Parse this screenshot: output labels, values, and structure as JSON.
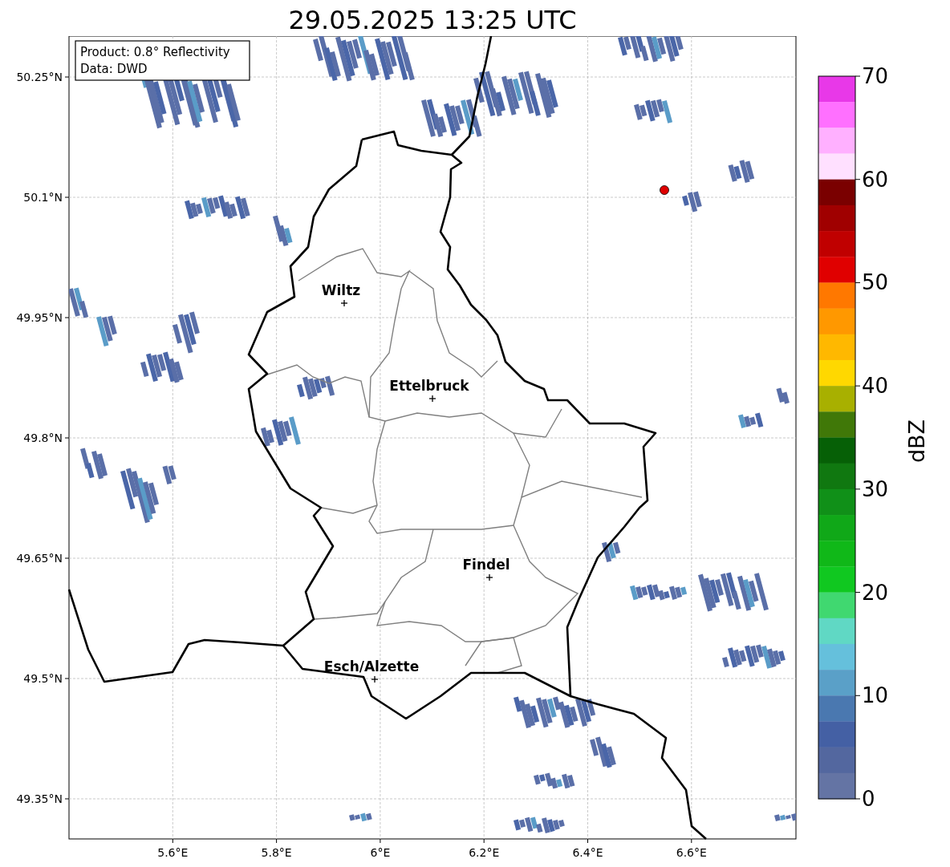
{
  "title": "29.05.2025 13:25 UTC",
  "info_box": {
    "lines": [
      "Product: 0.8° Reflectivity",
      "Data: DWD"
    ]
  },
  "map": {
    "x_axis_labels": [
      "5.6°E",
      "5.8°E",
      "6°E",
      "6.2°E",
      "6.4°E",
      "6.6°E"
    ],
    "y_axis_labels": [
      "50.25°N",
      "50.1°N",
      "49.95°N",
      "49.8°N",
      "49.65°N",
      "49.5°N",
      "49.35°N"
    ],
    "cities": [
      {
        "name": "Wiltz"
      },
      {
        "name": "Ettelbruck"
      },
      {
        "name": "Findel"
      },
      {
        "name": "Esch/Alzette"
      }
    ]
  },
  "colorbar": {
    "label": "dBZ",
    "ticks": [
      "70",
      "60",
      "50",
      "40",
      "30",
      "20",
      "10",
      "0"
    ],
    "bins": [
      {
        "color": "#e838e8"
      },
      {
        "color": "#ff70ff"
      },
      {
        "color": "#ffb0ff"
      },
      {
        "color": "#ffe0ff"
      },
      {
        "color": "#7a0000"
      },
      {
        "color": "#a00000"
      },
      {
        "color": "#c00000"
      },
      {
        "color": "#e00000"
      },
      {
        "color": "#ff7800"
      },
      {
        "color": "#ff9800"
      },
      {
        "color": "#ffb800"
      },
      {
        "color": "#ffd800"
      },
      {
        "color": "#a8b000"
      },
      {
        "color": "#407808"
      },
      {
        "color": "#066006"
      },
      {
        "color": "#107810"
      },
      {
        "color": "#109018"
      },
      {
        "color": "#10a818"
      },
      {
        "color": "#10b818"
      },
      {
        "color": "#10c820"
      },
      {
        "color": "#40d870"
      },
      {
        "color": "#60d8c4"
      },
      {
        "color": "#65c0dc"
      },
      {
        "color": "#5aa0c8"
      },
      {
        "color": "#4a78b0"
      },
      {
        "color": "#4460a4"
      },
      {
        "color": "#53679f"
      },
      {
        "color": "#6474a4"
      }
    ]
  }
}
